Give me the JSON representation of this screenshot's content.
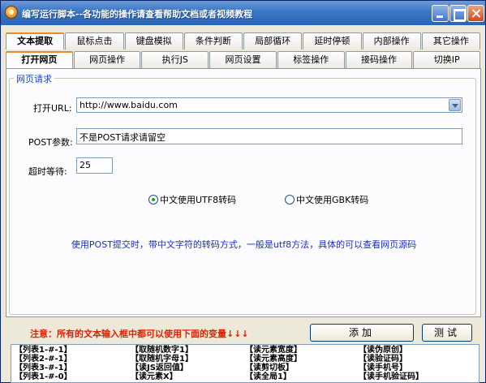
{
  "window": {
    "title": "编写运行脚本--各功能的操作请查看帮助文档或者视频教程"
  },
  "tabs_top": [
    "文本提取",
    "鼠标点击",
    "键盘模拟",
    "条件判断",
    "局部循环",
    "延时停顿",
    "内部操作",
    "其它操作"
  ],
  "tabs_top_active": "文本提取",
  "tabs_sub": [
    "打开网页",
    "网页操作",
    "执行JS",
    "网页设置",
    "标签操作",
    "接码操作",
    "切换IP"
  ],
  "tabs_sub_active": "打开网页",
  "group": {
    "title": "网页请求"
  },
  "form": {
    "url_label": "打开URL:",
    "url_value": "http://www.baidu.com",
    "post_label": "POST参数:",
    "post_value": "不是POST请求请留空",
    "timeout_label": "超时等待:",
    "timeout_value": "25"
  },
  "radios": {
    "utf8_label": "中文使用UTF8转码",
    "utf8_checked": true,
    "gbk_label": "中文使用GBK转码",
    "gbk_checked": false
  },
  "hint": "使用POST提交时，带中文字符的转码方式，一般是utf8方法，具体的可以查看网页源码",
  "notice": "注意：所有的文本输入框中都可以使用下面的变量↓↓↓",
  "buttons": {
    "add": "添加",
    "test": "测试"
  },
  "variables": [
    [
      "【列表1-#-1】",
      "【列表2-#-1】",
      "【列表3-#-1】",
      "【列表1-#-0】"
    ],
    [
      "【取随机数字1】",
      "【取随机字母1】",
      "【读JS返回值】",
      "【读元素X】"
    ],
    [
      "【读元素宽度】",
      "【读元素高度】",
      "【读剪切板】",
      "【读全局1】"
    ],
    [
      "【读伪原创】",
      "【读验证码】",
      "【读手机号】",
      "【读手机验证码】"
    ]
  ],
  "colors": {
    "notice": "#e02000",
    "hint": "#1a2fbf",
    "group_title": "#1a47bf",
    "titlebar": "#2a64b8"
  }
}
